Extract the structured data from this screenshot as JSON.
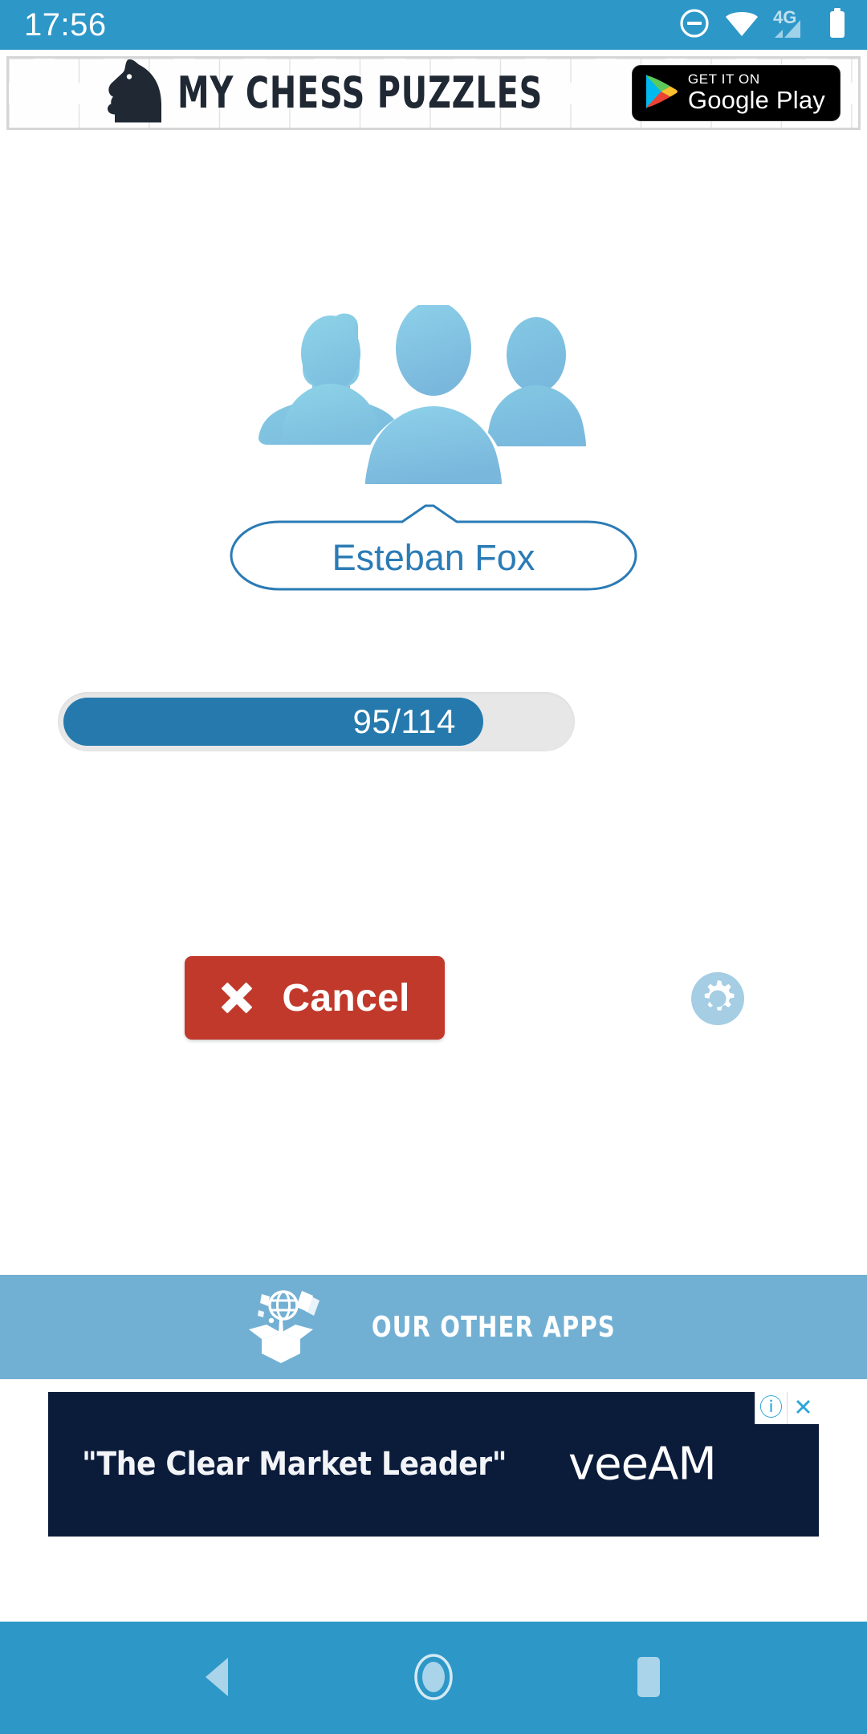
{
  "status_bar": {
    "time": "17:56",
    "network_label": "4G",
    "icons": [
      "do-not-disturb-icon",
      "wifi-icon",
      "signal-icon",
      "battery-icon"
    ],
    "background_color": "#2d97c8"
  },
  "promo_banner": {
    "app_name": "MY CHESS PUZZLES",
    "logo_icon": "chess-knight-puzzle-icon",
    "store_badge": {
      "prefix": "GET IT ON",
      "store": "Google Play",
      "icon": "google-play-icon"
    }
  },
  "main": {
    "people_icon": "people-group-icon",
    "player_name": "Esteban Fox",
    "progress": {
      "label": "95/114",
      "current": 95,
      "total": 114,
      "percent": 83,
      "fill_color": "#2579ad",
      "track_color": "#e7e7e7"
    },
    "cancel_button": {
      "label": "Cancel",
      "icon": "close-x-icon",
      "color": "#c0392b"
    },
    "settings_button": {
      "icon": "gear-icon",
      "color": "#a5cde3"
    }
  },
  "other_apps_bar": {
    "label": "OUR OTHER APPS",
    "icon": "open-box-icon",
    "background_color": "#72b0d3"
  },
  "ad": {
    "headline": "\"The Clear Market Leader\"",
    "brand": "veeAM",
    "info_badge": "ⓘ",
    "close_badge": "✕",
    "background_color": "#0b1b3a"
  },
  "nav_bar": {
    "back": "back-triangle-icon",
    "home": "home-circle-icon",
    "recents": "recents-square-icon",
    "background_color": "#2d97c8"
  }
}
